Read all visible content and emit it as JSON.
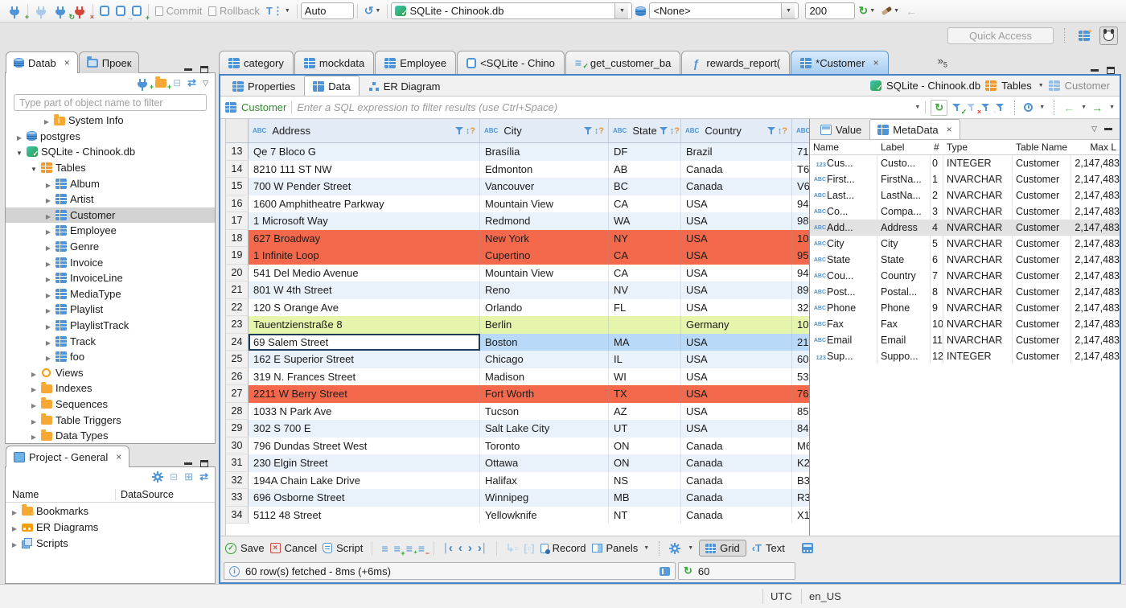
{
  "topbar": {
    "commit_label": "Commit",
    "rollback_label": "Rollback",
    "txn_mode": "Auto",
    "connection": "SQLite - Chinook.db",
    "schema": "<None>",
    "fetch_size": "200",
    "quick_access_placeholder": "Quick Access"
  },
  "nav": {
    "tab_database": "Datab",
    "tab_projects": "Проек",
    "filter_placeholder": "Type part of object name to filter",
    "tree": [
      {
        "label": "System Info",
        "icon": "info-folder-icon",
        "state": "collapsed",
        "indent": 46
      },
      {
        "label": "postgres",
        "icon": "database-icon",
        "state": "collapsed",
        "indent": 12
      },
      {
        "label": "SQLite - Chinook.db",
        "icon": "sqlite-icon",
        "state": "expanded",
        "indent": 12
      },
      {
        "label": "Tables",
        "icon": "tables-folder-icon",
        "state": "expanded",
        "indent": 30
      },
      {
        "label": "Album",
        "icon": "table-icon",
        "state": "collapsed",
        "indent": 48
      },
      {
        "label": "Artist",
        "icon": "table-icon",
        "state": "collapsed",
        "indent": 48
      },
      {
        "label": "Customer",
        "icon": "table-icon",
        "state": "collapsed",
        "indent": 48,
        "selected": true
      },
      {
        "label": "Employee",
        "icon": "table-icon",
        "state": "collapsed",
        "indent": 48
      },
      {
        "label": "Genre",
        "icon": "table-icon",
        "state": "collapsed",
        "indent": 48
      },
      {
        "label": "Invoice",
        "icon": "table-icon",
        "state": "collapsed",
        "indent": 48
      },
      {
        "label": "InvoiceLine",
        "icon": "table-icon",
        "state": "collapsed",
        "indent": 48
      },
      {
        "label": "MediaType",
        "icon": "table-icon",
        "state": "collapsed",
        "indent": 48
      },
      {
        "label": "Playlist",
        "icon": "table-icon",
        "state": "collapsed",
        "indent": 48
      },
      {
        "label": "PlaylistTrack",
        "icon": "table-icon",
        "state": "collapsed",
        "indent": 48
      },
      {
        "label": "Track",
        "icon": "table-icon",
        "state": "collapsed",
        "indent": 48
      },
      {
        "label": "foo",
        "icon": "table-icon",
        "state": "collapsed",
        "indent": 48
      },
      {
        "label": "Views",
        "icon": "views-icon",
        "state": "collapsed",
        "indent": 30
      },
      {
        "label": "Indexes",
        "icon": "folder-icon",
        "state": "collapsed",
        "indent": 30
      },
      {
        "label": "Sequences",
        "icon": "folder-icon",
        "state": "collapsed",
        "indent": 30
      },
      {
        "label": "Table Triggers",
        "icon": "folder-icon",
        "state": "collapsed",
        "indent": 30
      },
      {
        "label": "Data Types",
        "icon": "folder-icon",
        "state": "collapsed",
        "indent": 30
      }
    ]
  },
  "project": {
    "title": "Project - General",
    "col_name": "Name",
    "col_datasource": "DataSource",
    "items": [
      {
        "label": "Bookmarks",
        "icon": "bookmarks-folder-icon",
        "state": "collapsed"
      },
      {
        "label": "ER Diagrams",
        "icon": "er-diagrams-icon",
        "state": "collapsed"
      },
      {
        "label": "Scripts",
        "icon": "scripts-icon",
        "state": "collapsed"
      }
    ]
  },
  "editor_tabs": {
    "tabs": [
      {
        "label": "category",
        "icon": "table-icon"
      },
      {
        "label": "mockdata",
        "icon": "table-icon"
      },
      {
        "label": "Employee",
        "icon": "table-icon"
      },
      {
        "label": "<SQLite - Chino",
        "icon": "sql-console-icon"
      },
      {
        "label": "get_customer_ba",
        "icon": "script-checked-icon"
      },
      {
        "label": "rewards_report(",
        "icon": "function-icon"
      },
      {
        "label": "*Customer",
        "icon": "table-icon",
        "active": true,
        "closable": true
      }
    ],
    "more_count": "5"
  },
  "result_tabs": {
    "properties": "Properties",
    "data": "Data",
    "er": "ER Diagram"
  },
  "breadcrumb": {
    "db": "SQLite - Chinook.db",
    "tables": "Tables",
    "table": "Customer"
  },
  "filter": {
    "table": "Customer",
    "placeholder": "Enter a SQL expression to filter results (use Ctrl+Space)"
  },
  "grid": {
    "columns": [
      "Address",
      "City",
      "State",
      "Country"
    ],
    "rows": [
      {
        "n": "13",
        "address": "Qe 7 Bloco G",
        "city": "Brasília",
        "state": "DF",
        "country": "Brazil",
        "postal": "71",
        "hl": "stripe"
      },
      {
        "n": "14",
        "address": "8210 111 ST NW",
        "city": "Edmonton",
        "state": "AB",
        "country": "Canada",
        "postal": "T6"
      },
      {
        "n": "15",
        "address": "700 W Pender Street",
        "city": "Vancouver",
        "state": "BC",
        "country": "Canada",
        "postal": "V6",
        "hl": "stripe"
      },
      {
        "n": "16",
        "address": "1600 Amphitheatre Parkway",
        "city": "Mountain View",
        "state": "CA",
        "country": "USA",
        "postal": "94"
      },
      {
        "n": "17",
        "address": "1 Microsoft Way",
        "city": "Redmond",
        "state": "WA",
        "country": "USA",
        "postal": "98",
        "hl": "stripe"
      },
      {
        "n": "18",
        "address": "627 Broadway",
        "city": "New York",
        "state": "NY",
        "country": "USA",
        "postal": "10",
        "hl": "red"
      },
      {
        "n": "19",
        "address": "1 Infinite Loop",
        "city": "Cupertino",
        "state": "CA",
        "country": "USA",
        "postal": "95",
        "hl": "red"
      },
      {
        "n": "20",
        "address": "541 Del Medio Avenue",
        "city": "Mountain View",
        "state": "CA",
        "country": "USA",
        "postal": "94"
      },
      {
        "n": "21",
        "address": "801 W 4th Street",
        "city": "Reno",
        "state": "NV",
        "country": "USA",
        "postal": "89",
        "hl": "stripe"
      },
      {
        "n": "22",
        "address": "120 S Orange Ave",
        "city": "Orlando",
        "state": "FL",
        "country": "USA",
        "postal": "32"
      },
      {
        "n": "23",
        "address": "Tauentzienstraße 8",
        "city": "Berlin",
        "state": "",
        "country": "Germany",
        "postal": "10",
        "hl": "green"
      },
      {
        "n": "24",
        "address": "69 Salem Street",
        "city": "Boston",
        "state": "MA",
        "country": "USA",
        "postal": "21",
        "hl": "selected",
        "focused": true
      },
      {
        "n": "25",
        "address": "162 E Superior Street",
        "city": "Chicago",
        "state": "IL",
        "country": "USA",
        "postal": "60",
        "hl": "stripe"
      },
      {
        "n": "26",
        "address": "319 N. Frances Street",
        "city": "Madison",
        "state": "WI",
        "country": "USA",
        "postal": "53"
      },
      {
        "n": "27",
        "address": "2211 W Berry Street",
        "city": "Fort Worth",
        "state": "TX",
        "country": "USA",
        "postal": "76",
        "hl": "red"
      },
      {
        "n": "28",
        "address": "1033 N Park Ave",
        "city": "Tucson",
        "state": "AZ",
        "country": "USA",
        "postal": "85"
      },
      {
        "n": "29",
        "address": "302 S 700 E",
        "city": "Salt Lake City",
        "state": "UT",
        "country": "USA",
        "postal": "84",
        "hl": "stripe"
      },
      {
        "n": "30",
        "address": "796 Dundas Street West",
        "city": "Toronto",
        "state": "ON",
        "country": "Canada",
        "postal": "M6"
      },
      {
        "n": "31",
        "address": "230 Elgin Street",
        "city": "Ottawa",
        "state": "ON",
        "country": "Canada",
        "postal": "K2",
        "hl": "stripe"
      },
      {
        "n": "32",
        "address": "194A Chain Lake Drive",
        "city": "Halifax",
        "state": "NS",
        "country": "Canada",
        "postal": "B3"
      },
      {
        "n": "33",
        "address": "696 Osborne Street",
        "city": "Winnipeg",
        "state": "MB",
        "country": "Canada",
        "postal": "R3",
        "hl": "stripe"
      },
      {
        "n": "34",
        "address": "5112 48 Street",
        "city": "Yellowknife",
        "state": "NT",
        "country": "Canada",
        "postal": "X1"
      }
    ]
  },
  "meta": {
    "tab_value": "Value",
    "tab_metadata": "MetaData",
    "columns": {
      "name": "Name",
      "label": "Label",
      "num": "#",
      "type": "Type",
      "table": "Table Name",
      "max": "Max L"
    },
    "rows": [
      {
        "icon": "numeric-icon",
        "name": "Cus...",
        "label": "Custo...",
        "num": "0",
        "type": "INTEGER",
        "table": "Customer",
        "max": "2,147,483"
      },
      {
        "icon": "string-icon",
        "name": "First...",
        "label": "FirstNa...",
        "num": "1",
        "type": "NVARCHAR",
        "table": "Customer",
        "max": "2,147,483"
      },
      {
        "icon": "string-icon",
        "name": "Last...",
        "label": "LastNa...",
        "num": "2",
        "type": "NVARCHAR",
        "table": "Customer",
        "max": "2,147,483"
      },
      {
        "icon": "string-icon",
        "name": "Co...",
        "label": "Compa...",
        "num": "3",
        "type": "NVARCHAR",
        "table": "Customer",
        "max": "2,147,483"
      },
      {
        "icon": "string-icon",
        "name": "Add...",
        "label": "Address",
        "num": "4",
        "type": "NVARCHAR",
        "table": "Customer",
        "max": "2,147,483",
        "selected": true
      },
      {
        "icon": "string-icon",
        "name": "City",
        "label": "City",
        "num": "5",
        "type": "NVARCHAR",
        "table": "Customer",
        "max": "2,147,483"
      },
      {
        "icon": "string-icon",
        "name": "State",
        "label": "State",
        "num": "6",
        "type": "NVARCHAR",
        "table": "Customer",
        "max": "2,147,483"
      },
      {
        "icon": "string-icon",
        "name": "Cou...",
        "label": "Country",
        "num": "7",
        "type": "NVARCHAR",
        "table": "Customer",
        "max": "2,147,483"
      },
      {
        "icon": "string-icon",
        "name": "Post...",
        "label": "Postal...",
        "num": "8",
        "type": "NVARCHAR",
        "table": "Customer",
        "max": "2,147,483"
      },
      {
        "icon": "string-icon",
        "name": "Phone",
        "label": "Phone",
        "num": "9",
        "type": "NVARCHAR",
        "table": "Customer",
        "max": "2,147,483"
      },
      {
        "icon": "string-icon",
        "name": "Fax",
        "label": "Fax",
        "num": "10",
        "type": "NVARCHAR",
        "table": "Customer",
        "max": "2,147,483"
      },
      {
        "icon": "string-icon",
        "name": "Email",
        "label": "Email",
        "num": "11",
        "type": "NVARCHAR",
        "table": "Customer",
        "max": "2,147,483"
      },
      {
        "icon": "numeric-icon",
        "name": "Sup...",
        "label": "Suppo...",
        "num": "12",
        "type": "INTEGER",
        "table": "Customer",
        "max": "2,147,483"
      }
    ]
  },
  "bottom": {
    "save": "Save",
    "cancel": "Cancel",
    "script": "Script",
    "record": "Record",
    "panels": "Panels",
    "grid": "Grid",
    "text": "Text",
    "status": "60 row(s) fetched - 8ms (+6ms)",
    "refresh_seconds": "60"
  },
  "statusbar": {
    "timezone": "UTC",
    "locale": "en_US"
  }
}
